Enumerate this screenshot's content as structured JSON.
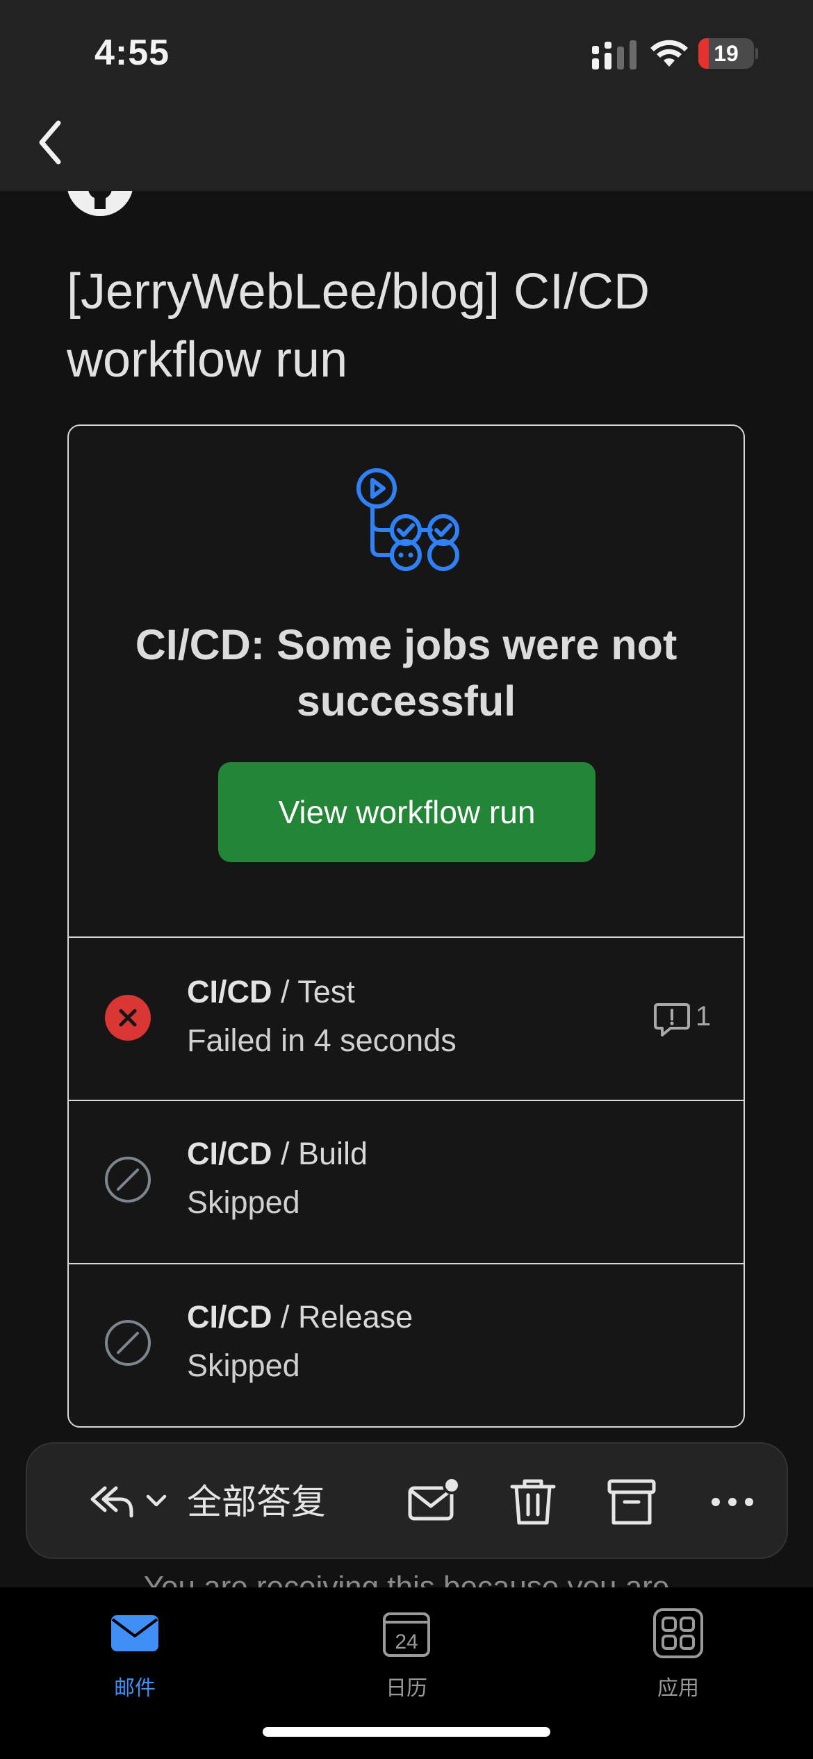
{
  "status_bar": {
    "time": "4:55",
    "battery_level": "19",
    "battery_fraction": 0.19
  },
  "nav": {
    "back_icon": "chevron-left-icon"
  },
  "email": {
    "sender_icon": "github-icon",
    "subject": "[JerryWebLee/blog] CI/CD workflow run",
    "card": {
      "header_icon": "github-actions-icon",
      "title": "CI/CD: Some jobs were not successful",
      "button_label": "View workflow run",
      "jobs": [
        {
          "workflow": "CI/CD",
          "separator": " / ",
          "name": "Test",
          "detail": "Failed in 4 seconds",
          "status": "failed",
          "annotation_count": "1"
        },
        {
          "workflow": "CI/CD",
          "separator": " / ",
          "name": "Build",
          "detail": "Skipped",
          "status": "skipped"
        },
        {
          "workflow": "CI/CD",
          "separator": " / ",
          "name": "Release",
          "detail": "Skipped",
          "status": "skipped"
        }
      ]
    },
    "footer_peek": "You are receiving this because you are"
  },
  "action_bar": {
    "reply_all_label": "全部答复",
    "icons": [
      "reply-all-icon",
      "chevron-down-icon",
      "mark-unread-icon",
      "trash-icon",
      "archive-icon",
      "more-icon"
    ]
  },
  "tab_bar": {
    "tabs": [
      {
        "label": "邮件",
        "icon": "mail-icon",
        "active": true
      },
      {
        "label": "日历",
        "icon": "calendar-icon",
        "day": "24",
        "active": false
      },
      {
        "label": "应用",
        "icon": "apps-icon",
        "active": false
      }
    ]
  },
  "colors": {
    "accent_blue": "#3f8ff7",
    "button_green": "#238636",
    "failed_red": "#da3633",
    "battery_red": "#e5322d"
  }
}
